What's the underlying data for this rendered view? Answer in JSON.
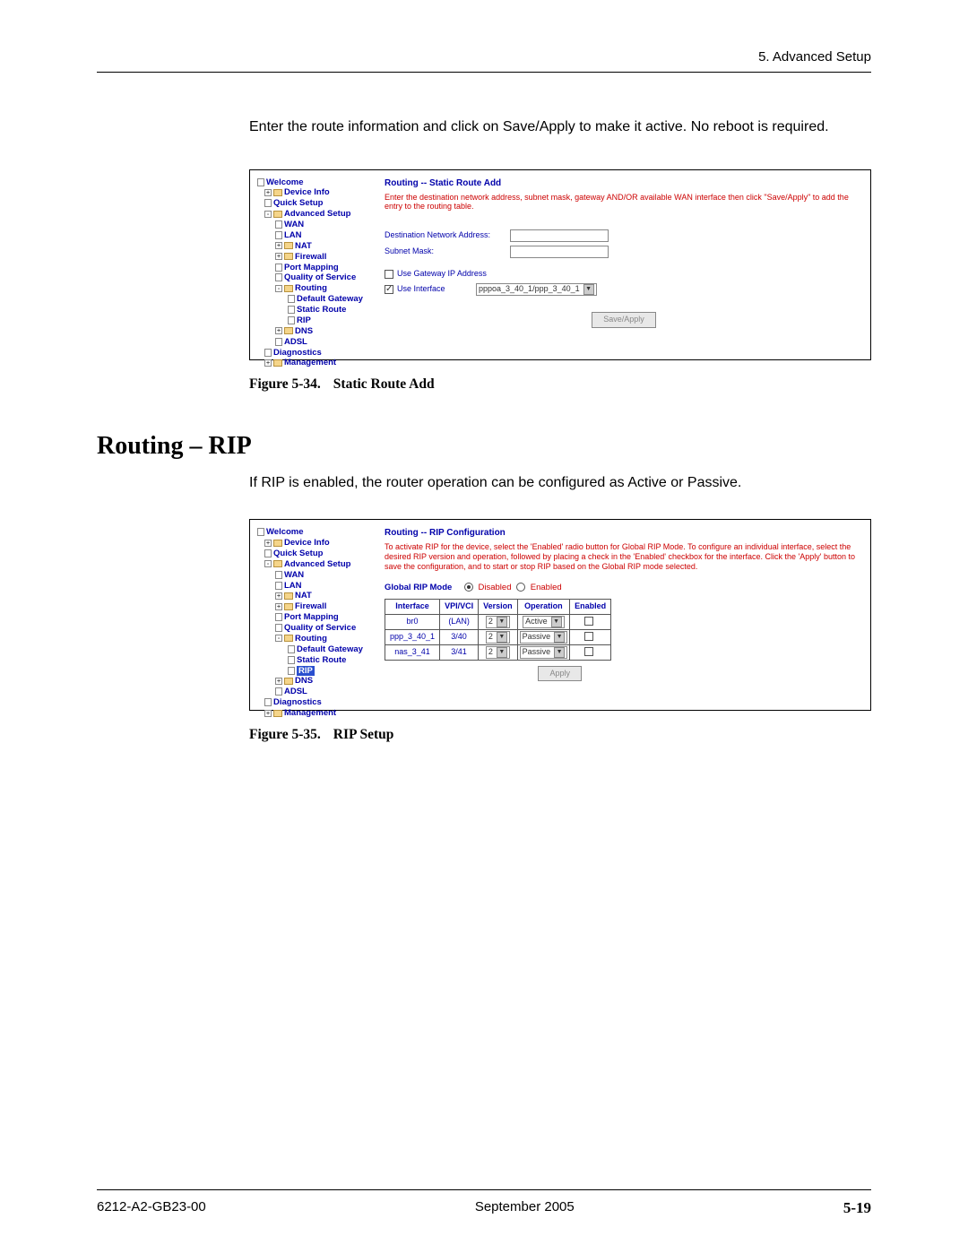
{
  "header": {
    "chapter": "5. Advanced Setup"
  },
  "intro1": "Enter the route information and click on Save/Apply to make it active. No reboot is required.",
  "caption1_num": "Figure 5-34.",
  "caption1_txt": "Static Route Add",
  "section_heading": "Routing – RIP",
  "intro2": "If RIP is enabled, the router operation can be configured as Active or Passive.",
  "caption2_num": "Figure 5-35.",
  "caption2_txt": "RIP Setup",
  "footer": {
    "doc": "6212-A2-GB23-00",
    "date": "September 2005",
    "page": "5-19"
  },
  "tree": {
    "welcome": "Welcome",
    "device_info": "Device Info",
    "quick_setup": "Quick Setup",
    "advanced_setup": "Advanced Setup",
    "wan": "WAN",
    "lan": "LAN",
    "nat": "NAT",
    "firewall": "Firewall",
    "port_mapping": "Port Mapping",
    "qos": "Quality of Service",
    "routing": "Routing",
    "default_gateway": "Default Gateway",
    "static_route": "Static Route",
    "rip": "RIP",
    "dns": "DNS",
    "adsl": "ADSL",
    "diagnostics": "Diagnostics",
    "management": "Management"
  },
  "shot1": {
    "title": "Routing -- Static Route Add",
    "desc": "Enter the destination network address, subnet mask, gateway AND/OR available WAN interface then click \"Save/Apply\" to add the entry to the routing table.",
    "dest_label": "Destination Network Address:",
    "mask_label": "Subnet Mask:",
    "gw_label": "Use Gateway IP Address",
    "if_label": "Use Interface",
    "if_value": "pppoa_3_40_1/ppp_3_40_1",
    "btn": "Save/Apply"
  },
  "shot2": {
    "title": "Routing -- RIP Configuration",
    "desc": "To activate RIP for the device, select the 'Enabled' radio button for Global RIP Mode. To configure an individual interface, select the desired RIP version and operation, followed by placing a check in the 'Enabled' checkbox for the interface. Click the 'Apply' button to save the configuration, and to start or stop RIP based on the Global RIP mode selected.",
    "mode_label": "Global RIP Mode",
    "disabled": "Disabled",
    "enabled": "Enabled",
    "th": {
      "if": "Interface",
      "vpi": "VPI/VCI",
      "ver": "Version",
      "op": "Operation",
      "en": "Enabled"
    },
    "rows": [
      {
        "if": "br0",
        "vpi": "(LAN)",
        "ver": "2",
        "op": "Active"
      },
      {
        "if": "ppp_3_40_1",
        "vpi": "3/40",
        "ver": "2",
        "op": "Passive"
      },
      {
        "if": "nas_3_41",
        "vpi": "3/41",
        "ver": "2",
        "op": "Passive"
      }
    ],
    "btn": "Apply"
  }
}
